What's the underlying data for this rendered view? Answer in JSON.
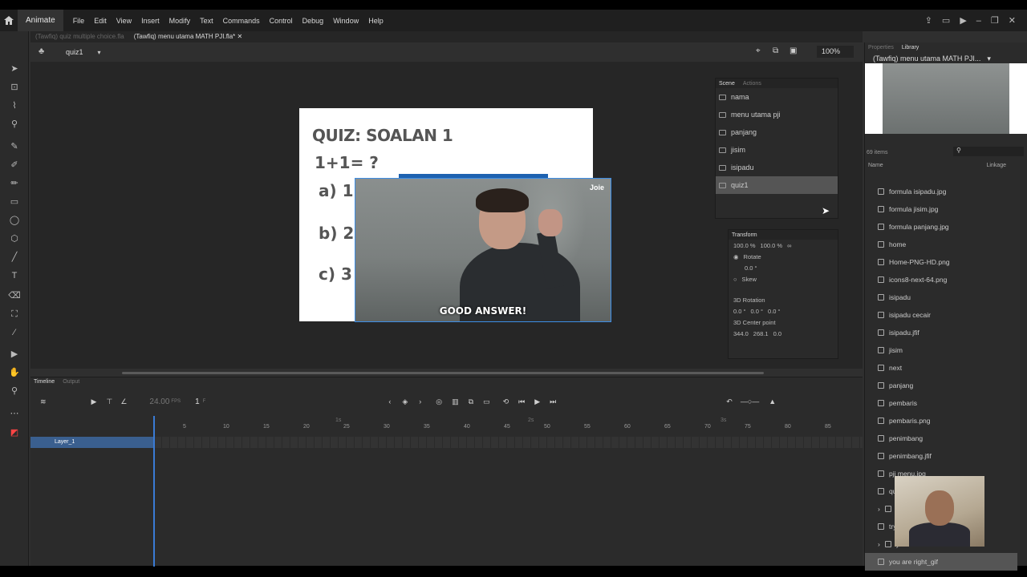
{
  "menubar": {
    "app_name": "Animate",
    "items": [
      "File",
      "Edit",
      "View",
      "Insert",
      "Modify",
      "Text",
      "Commands",
      "Control",
      "Debug",
      "Window",
      "Help"
    ]
  },
  "doc_tabs": [
    "(Tawfiq) quiz multiple choice.fla",
    "(Tawfiq) menu utama MATH PJI.fla*"
  ],
  "stage": {
    "scene_name": "quiz1",
    "zoom": "100%",
    "quiz_title": "QUIZ: SOALAN 1",
    "question": "1+1= ?",
    "options": [
      "a) 1",
      "b) 2",
      "c) 3"
    ],
    "gif_caption": "GOOD ANSWER!",
    "gif_watermark": "Joie"
  },
  "scene_panel": {
    "tabs": [
      "Scene",
      "Actions"
    ],
    "scenes": [
      "nama",
      "menu utama pji",
      "panjang",
      "jisim",
      "isipadu",
      "quiz1"
    ],
    "selected": "quiz1"
  },
  "transform_panel": {
    "title": "Transform",
    "width": "100.0 %",
    "height": "100.0 %",
    "rotate_label": "Rotate",
    "rotate_value": "0.0 °",
    "skew_label": "Skew",
    "rot3d_label": "3D Rotation",
    "rot3d": {
      "x": "0.0 °",
      "y": "0.0 °",
      "z": "0.0 °"
    },
    "center_label": "3D Center point",
    "center": {
      "x": "344.0",
      "y": "268.1",
      "z": "0.0"
    }
  },
  "timeline": {
    "tabs": [
      "Timeline",
      "Output"
    ],
    "fps": "24.00",
    "fps_unit": "FPS",
    "frame": "1",
    "frame_unit": "F",
    "layer_name": "Layer_1",
    "ruler_marks": [
      "5",
      "10",
      "15",
      "20",
      "25",
      "30",
      "35",
      "40",
      "45",
      "50",
      "55",
      "60",
      "65",
      "70",
      "75",
      "80",
      "85"
    ],
    "second_marks": [
      "1s",
      "2s",
      "3s"
    ]
  },
  "library": {
    "tabs": [
      "Properties",
      "Library"
    ],
    "doc_name": "(Tawfiq) menu utama MATH PJI...",
    "count": "69 items",
    "col_name": "Name",
    "col_linkage": "Linkage",
    "items": [
      "formula isipadu.jpg",
      "formula jisim.jpg",
      "formula panjang.jpg",
      "home",
      "Home-PNG-HD.png",
      "icons8-next-64.png",
      "isipadu",
      "isipadu cecair",
      "isipadu.jfif",
      "jisim",
      "next",
      "panjang",
      "pembaris",
      "pembaris.png",
      "penimbang",
      "penimbang.jfif",
      "pji menu.jpg",
      "qu",
      "try",
      "try",
      "yo",
      "you are right_gif"
    ],
    "selected": "you are right_gif"
  },
  "colors": {
    "accent": "#3a7bd5",
    "panel": "#2a2a2a",
    "menubar": "#1f1f1f"
  }
}
